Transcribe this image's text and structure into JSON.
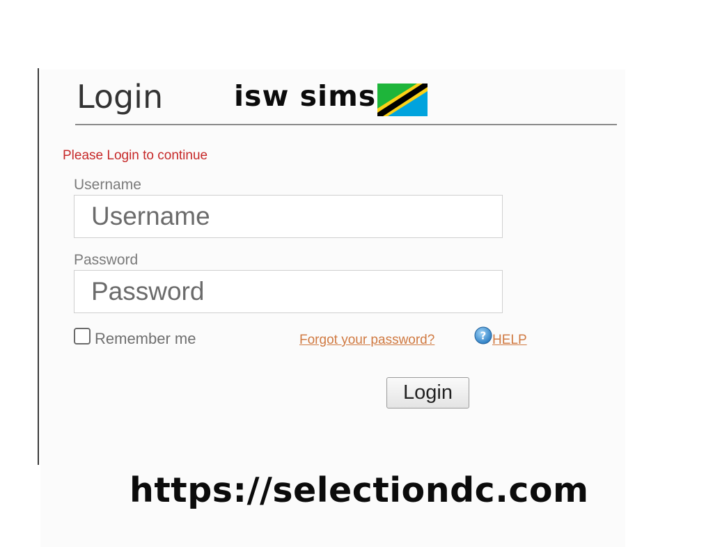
{
  "header": {
    "title": "Login",
    "brand": "isw sims",
    "flag_icon": "tanzania-flag-icon"
  },
  "form": {
    "message": "Please Login to continue",
    "username": {
      "label": "Username",
      "placeholder": "Username",
      "value": ""
    },
    "password": {
      "label": "Password",
      "placeholder": "Password",
      "value": ""
    },
    "remember_label": "Remember me",
    "remember_checked": false,
    "forgot_link": "Forgot your password?",
    "help_icon": "question-circle-icon",
    "help_link": "HELP",
    "submit_label": "Login"
  },
  "footer": {
    "url": "https://selectiondc.com"
  },
  "colors": {
    "error": "#c62828",
    "link": "#d07a42",
    "flag_green": "#1eb53a",
    "flag_blue": "#00a3dd",
    "flag_yellow": "#fcd116",
    "flag_black": "#000000"
  }
}
